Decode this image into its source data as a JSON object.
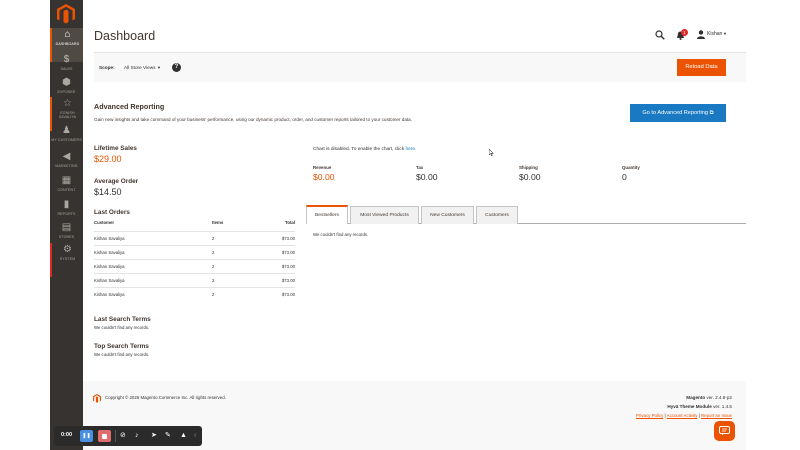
{
  "sidebar": {
    "items": [
      {
        "label": "DASHBOARD",
        "icon": "home-icon"
      },
      {
        "label": "SALES",
        "icon": "dollar-icon"
      },
      {
        "label": "EXPOSEE",
        "icon": "box-icon"
      },
      {
        "label": "EGNISH SAVALIYA",
        "icon": "star-icon"
      },
      {
        "label": "MY CUSTOMERS",
        "icon": "user-icon"
      },
      {
        "label": "MARKETING",
        "icon": "megaphone-icon"
      },
      {
        "label": "CONTENT",
        "icon": "content-icon"
      },
      {
        "label": "REPORTS",
        "icon": "bar-chart-icon"
      },
      {
        "label": "STORES",
        "icon": "store-icon"
      },
      {
        "label": "SYSTEM",
        "icon": "gear-icon"
      }
    ]
  },
  "header": {
    "title": "Dashboard",
    "notification_count": "1",
    "user_name": "Kishan"
  },
  "scope": {
    "label": "Scope:",
    "value": "All Store Views",
    "reload_label": "Reload Data"
  },
  "advanced": {
    "title": "Advanced Reporting",
    "description": "Gain new insights and take command of your business' performance, using our dynamic product, order, and customer reports tailored to your customer data.",
    "button_label": "Go to Advanced Reporting"
  },
  "stats": {
    "lifetime_label": "Lifetime Sales",
    "lifetime_value": "$29.00",
    "average_label": "Average Order",
    "average_value": "$14.50"
  },
  "last_orders": {
    "title": "Last Orders",
    "headers": [
      "Customer",
      "Items",
      "Total"
    ],
    "rows": [
      {
        "customer": "Kishan Savaliya",
        "items": "2",
        "total": "$73.00"
      },
      {
        "customer": "Kishan Savaliya",
        "items": "2",
        "total": "$73.00"
      },
      {
        "customer": "Kishan Savaliya",
        "items": "2",
        "total": "$73.00"
      },
      {
        "customer": "Kishan Savaliya",
        "items": "2",
        "total": "$73.00"
      },
      {
        "customer": "Kishan Savaliya",
        "items": "2",
        "total": "$73.00"
      }
    ]
  },
  "search_terms": {
    "last_title": "Last Search Terms",
    "last_note": "We couldn't find any records.",
    "top_title": "Top Search Terms",
    "top_note": "We couldn't find any records."
  },
  "chart": {
    "note": "Chart is disabled. To enable the chart, click",
    "link": "here."
  },
  "metrics": [
    {
      "label": "Revenue",
      "value": "$0.00",
      "color": "#eb5202"
    },
    {
      "label": "Tax",
      "value": "$0.00",
      "color": "#303030"
    },
    {
      "label": "Shipping",
      "value": "$0.00",
      "color": "#303030"
    },
    {
      "label": "Quantity",
      "value": "0",
      "color": "#303030"
    }
  ],
  "tabs": {
    "items": [
      "Bestsellers",
      "Most Viewed Products",
      "New Customers",
      "Customers"
    ],
    "active": "Bestsellers",
    "note": "We couldn't find any records."
  },
  "footer": {
    "copyright": "Copyright © 2026 Magento Commerce Inc. All rights reserved.",
    "version_brand": "Magento",
    "version_text": "ver. 2.4.8-p2",
    "theme_brand": "Hyvä Theme Module",
    "theme_text": "ver. 1.4.5",
    "privacy": "Privacy Policy",
    "separator": "|",
    "activity": "Account Activity",
    "report": "Report an Issue"
  },
  "recorder": {
    "time": "0:00"
  },
  "colors": {
    "accent": "#eb5202",
    "sidebar": "#373330",
    "link": "#1979c3"
  }
}
